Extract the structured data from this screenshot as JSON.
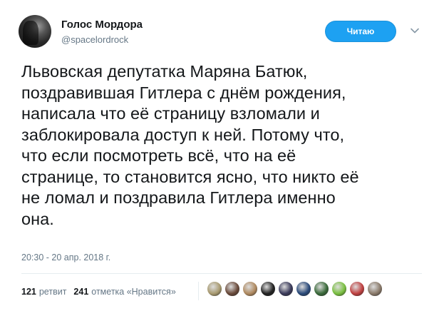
{
  "author": {
    "display_name": "Голос Мордора",
    "handle": "@spacelordrock",
    "follow_label": "Читаю"
  },
  "tweet": {
    "text": "Львовская депутатка Маряна Батюк,\nпоздравившая Гитлера с днём рождения,\nнаписала что её страницу взломали и\nзаблокировала доступ к ней. Потому что,\nчто если посмотреть всё, что на её\nстранице, то становится ясно, что никто её\nне ломал и поздравила Гитлера именно\nона.",
    "timestamp": "20:30 - 20 апр. 2018 г."
  },
  "stats": {
    "retweets_count": "121",
    "retweets_label": "ретвит",
    "likes_count": "241",
    "likes_label": "отметка «Нравится»"
  },
  "likers": [
    {
      "name": "liker-avatar-1",
      "color": "#a89a70"
    },
    {
      "name": "liker-avatar-2",
      "color": "#6a4a3a"
    },
    {
      "name": "liker-avatar-3",
      "color": "#b08a60"
    },
    {
      "name": "liker-avatar-4",
      "color": "#222222"
    },
    {
      "name": "liker-avatar-5",
      "color": "#3a3a5a"
    },
    {
      "name": "liker-avatar-6",
      "color": "#2a4a7a"
    },
    {
      "name": "liker-avatar-7",
      "color": "#3a6a3a"
    },
    {
      "name": "liker-avatar-8",
      "color": "#7ac040"
    },
    {
      "name": "liker-avatar-9",
      "color": "#c04040"
    },
    {
      "name": "liker-avatar-10",
      "color": "#8a7a6a"
    }
  ],
  "colors": {
    "accent": "#1da1f2",
    "muted": "#657786",
    "text": "#14171a"
  }
}
